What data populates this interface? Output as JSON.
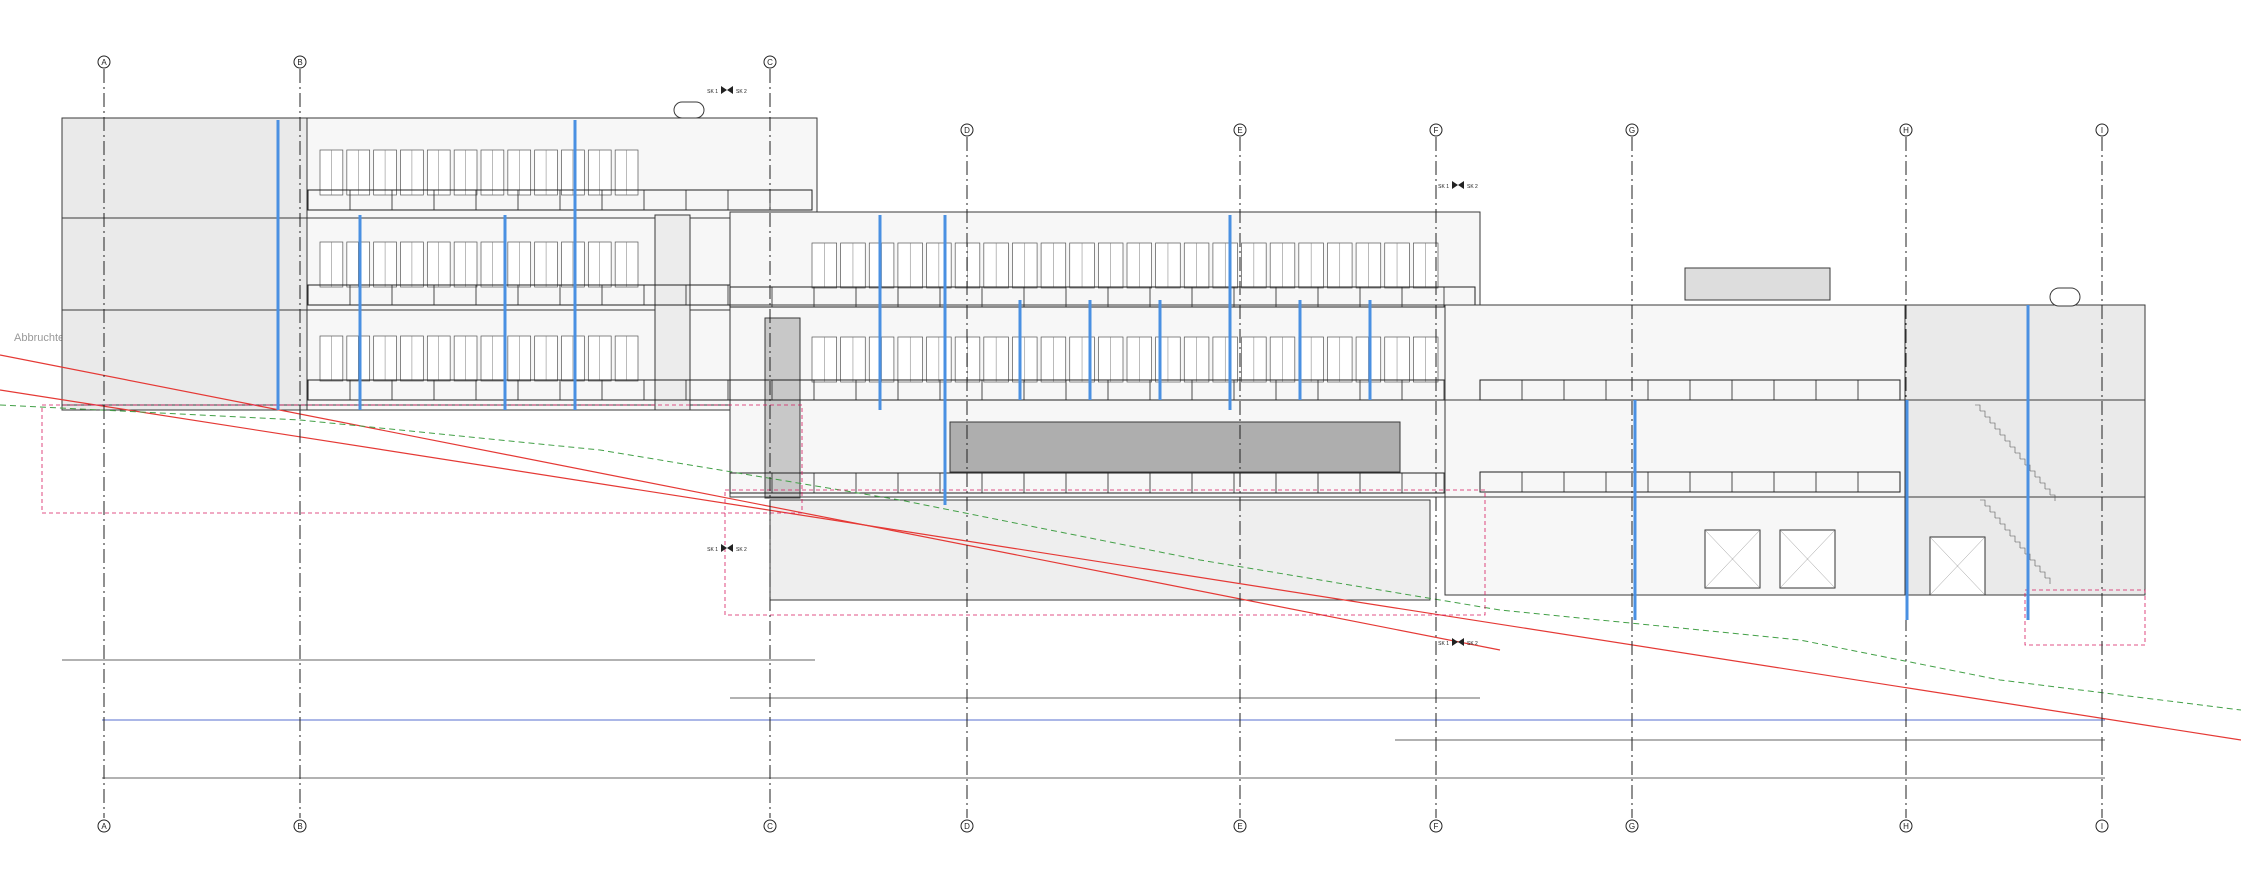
{
  "drawing": {
    "sheet_label": "Abbruchteil",
    "grid_axes_top": [
      "A",
      "B",
      "C",
      "D",
      "E",
      "F",
      "G",
      "H",
      "I"
    ],
    "grid_axes_bottom": [
      "A",
      "B",
      "C",
      "D",
      "E",
      "F",
      "G",
      "H",
      "I"
    ],
    "section_marks": [
      "SK 1",
      "SK 2"
    ],
    "colors": {
      "linework": "#3a3a3a",
      "light_linework": "#9a9a9a",
      "terrain_cut": "#e53935",
      "existing_terrain": "#43a047",
      "downpipe": "#4a90e2",
      "annotation_red": "#d81b60",
      "dimension_blue": "#1f3fbf"
    }
  }
}
